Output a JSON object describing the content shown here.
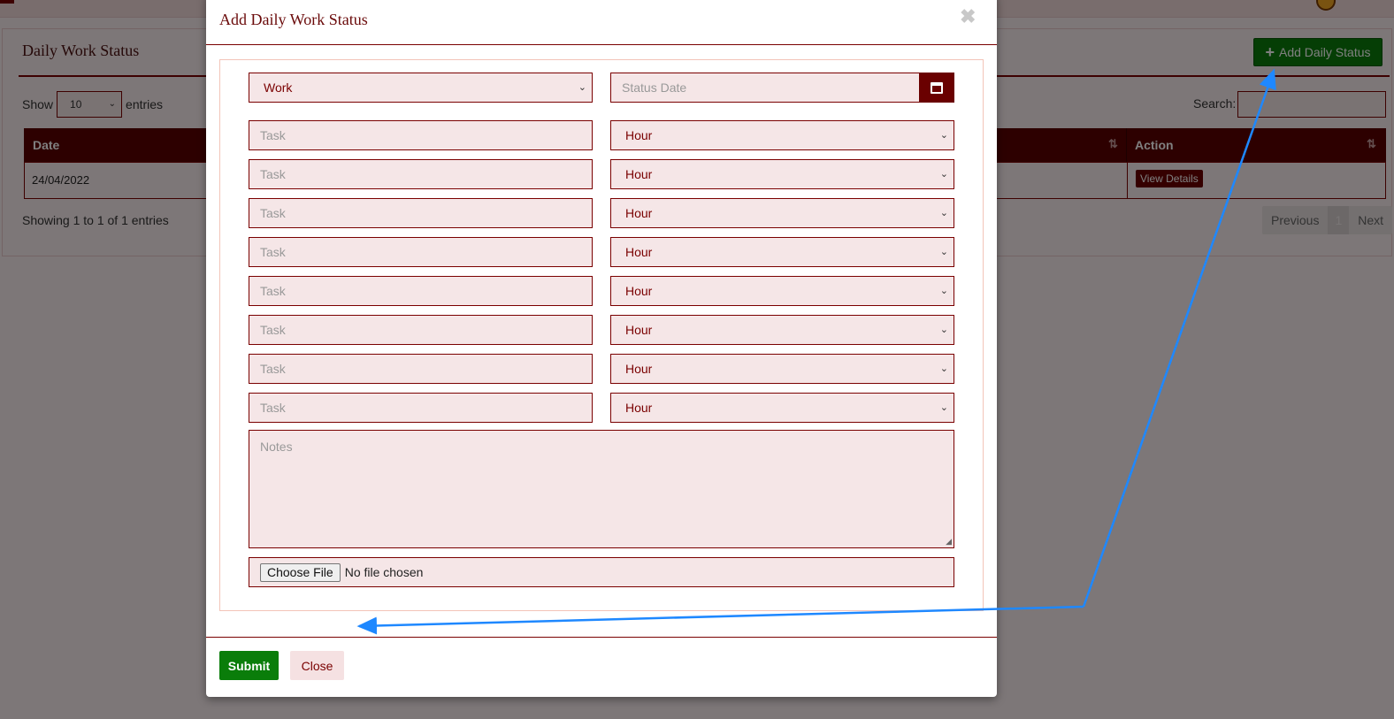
{
  "page": {
    "panel_title": "Daily Work Status",
    "add_button_label": "Add Daily Status",
    "show_label": "Show",
    "entries_label": "entries",
    "page_length": "10",
    "search_label": "Search:",
    "table": {
      "columns": [
        "Date",
        "Action"
      ],
      "rows": [
        {
          "date": "24/04/2022",
          "action_label": "View Details"
        }
      ]
    },
    "info_text": "Showing 1 to 1 of 1 entries",
    "pagination": {
      "previous": "Previous",
      "current": "1",
      "next": "Next"
    }
  },
  "modal": {
    "title": "Add Daily Work Status",
    "close_icon": "✖",
    "type_select_value": "Work",
    "status_date_placeholder": "Status Date",
    "task_placeholder": "Task",
    "hour_select_value": "Hour",
    "task_rows": 8,
    "notes_placeholder": "Notes",
    "file_button_label": "Choose File",
    "file_status": "No file chosen",
    "submit_label": "Submit",
    "close_label": "Close"
  },
  "colors": {
    "primary": "#7a0000",
    "header_dark": "#5a0000",
    "success": "#0a7d0a",
    "field_bg": "#f5e6e7",
    "annotation_arrow": "#1e88ff"
  }
}
